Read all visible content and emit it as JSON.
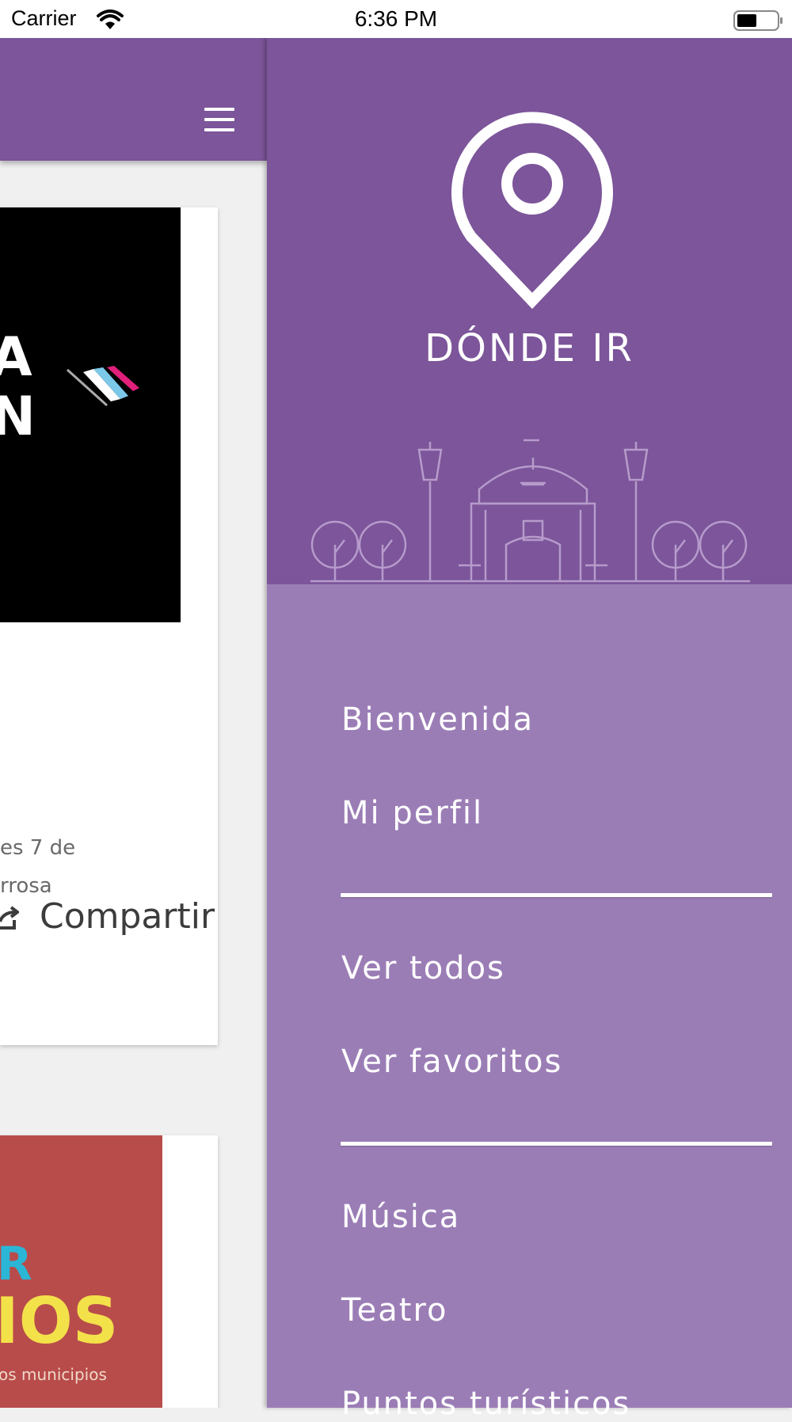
{
  "status_bar": {
    "carrier": "Carrier",
    "time": "6:36 PM"
  },
  "background_app": {
    "card1": {
      "image_fragment": [
        "A",
        "N"
      ],
      "desc_line1": "es 7 de",
      "desc_line2": "rrosa",
      "share_label": "Compartir"
    },
    "card2": {
      "image_fragment": [
        "R",
        "IOS",
        "os municipios"
      ]
    }
  },
  "drawer": {
    "brand": "DÓNDE IR",
    "items_group1": [
      "Bienvenida",
      "Mi perfil"
    ],
    "items_group2": [
      "Ver todos",
      "Ver favoritos"
    ],
    "items_group3": [
      "Música",
      "Teatro",
      "Puntos turísticos"
    ]
  },
  "colors": {
    "primary": "#7c559a",
    "menu_bg": "#9b7db6",
    "card_red": "#b84c4b",
    "accent_yellow": "#f3e14a",
    "accent_cyan": "#2bb6d6"
  }
}
